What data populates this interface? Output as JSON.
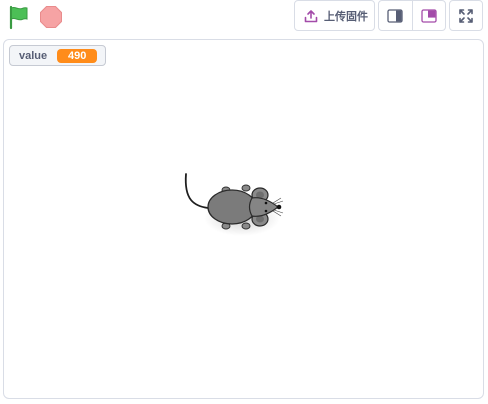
{
  "toolbar": {
    "upload_label": "上传固件"
  },
  "stage": {
    "monitor": {
      "name": "value",
      "value": "490"
    },
    "sprite": "mouse"
  },
  "colors": {
    "flag": "#4cbf56",
    "stop": "#f6a3a4",
    "monitor_value": "#ff8c1a",
    "accent_icon": "#a34ba9",
    "border": "#d9dde6"
  }
}
